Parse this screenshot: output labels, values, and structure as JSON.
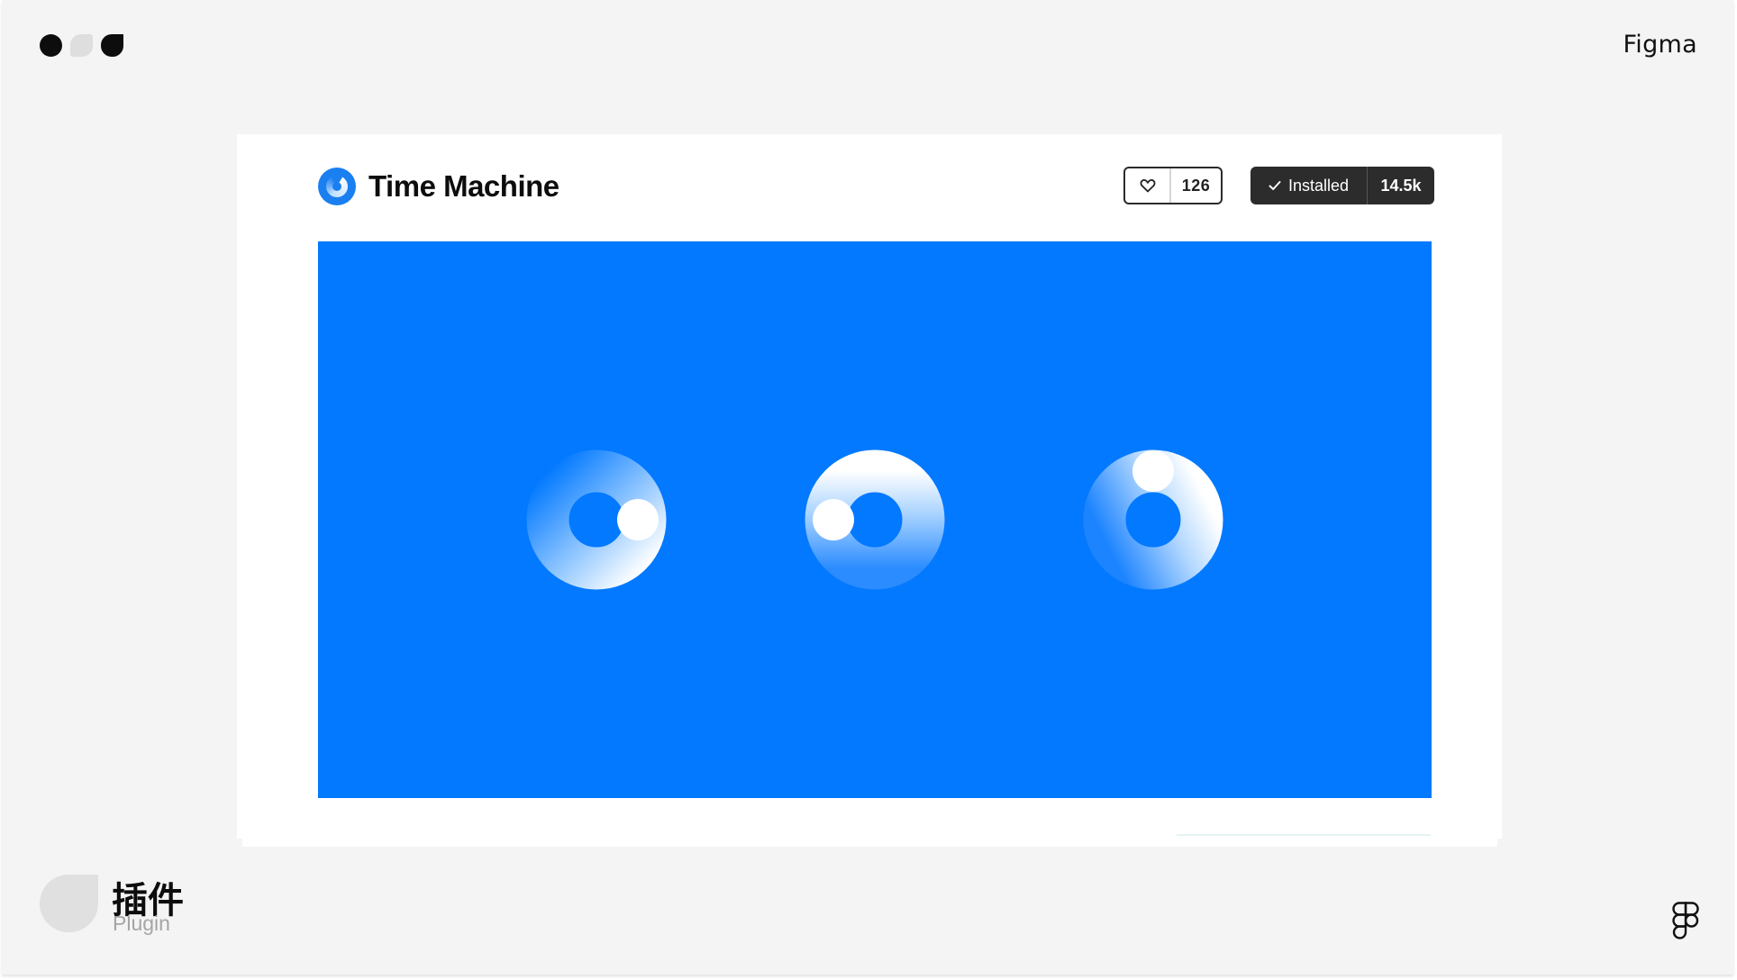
{
  "brand": {
    "label": "Figma"
  },
  "plugin": {
    "title": "Time Machine",
    "likes": "126",
    "install_state": "Installed",
    "install_count": "14.5k"
  },
  "category": {
    "label_zh": "插件",
    "label_en": "Plugin"
  },
  "colors": {
    "preview_background": "#0279ff",
    "install_button": "#2c2c2c",
    "slide_background": "#f4f4f4"
  },
  "icons": {
    "like": "heart-icon",
    "installed": "check-icon",
    "footer": "figma-logo-icon"
  }
}
